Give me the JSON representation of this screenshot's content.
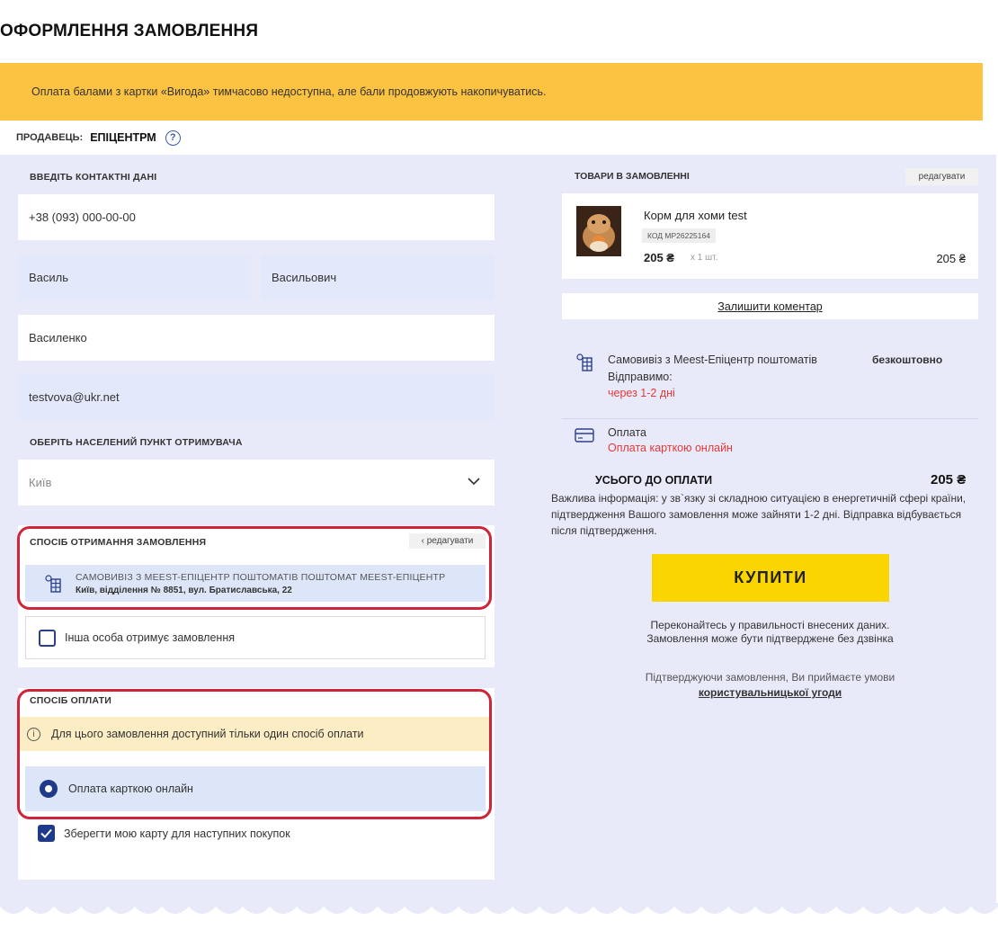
{
  "page_title": "ОФОРМЛЕННЯ ЗАМОВЛЕННЯ",
  "notice": "Оплата балами з картки «Вигода» тимчасово недоступна, але бали продовжують накопичуватись.",
  "seller": {
    "label": "ПРОДАВЕЦЬ:",
    "name": "ЕПІЦЕНТРМ"
  },
  "contacts": {
    "label": "ВВЕДІТЬ КОНТАКТНІ ДАНІ",
    "phone": "+38 (093) 000-00-00",
    "first_name": "Василь",
    "patronymic": "Васильович",
    "last_name": "Василенко",
    "email": "testvova@ukr.net"
  },
  "city": {
    "label": "ОБЕРІТЬ НАСЕЛЕНИЙ ПУНКТ ОТРИМУВАЧА",
    "value": "Київ"
  },
  "delivery": {
    "label": "СПОСІБ ОТРИМАННЯ ЗАМОВЛЕННЯ",
    "edit": "‹ редагувати",
    "option_title": "САМОВИВІЗ З MEEST-ЕПІЦЕНТР ПОШТОМАТІВ ПОШТОМАТ MEEST-ЕПІЦЕНТР",
    "option_address": "Київ, відділення № 8851, вул. Братиславська, 22",
    "other_person": "Інша особа отримує замовлення"
  },
  "payment": {
    "label": "СПОСІБ ОПЛАТИ",
    "info": "Для цього замовлення доступний тільки один спосіб оплати",
    "option": "Оплата карткою онлайн",
    "save_card": "Зберегти мою карту для наступних покупок"
  },
  "order": {
    "label": "ТОВАРИ В ЗАМОВЛЕННІ",
    "edit": "редагувати",
    "product_name": "Корм для хоми test",
    "product_code": "КОД MP26225164",
    "price": "205 ₴",
    "qty": "х 1 шт.",
    "total": "205 ₴",
    "comment": "Залишити коментар",
    "shipping_title": "Самовивіз з Meest-Епіцентр поштоматів",
    "shipping_price": "безкоштовно",
    "ship_when": "Відправимо:",
    "ship_eta": "через 1-2 дні",
    "pay_title": "Оплата",
    "pay_method": "Оплата карткою онлайн",
    "sum_label": "УСЬОГО ДО ОПЛАТИ",
    "sum_value": "205 ₴",
    "important": "Важлива інформація: у зв`язку зі складною ситуацією в енергетичній сфері країни, підтвердження Вашого замовлення може зайняти 1-2 дні. Відправка відбувається після підтвердження.",
    "buy": "КУПИТИ",
    "check_1": "Переконайтесь у правильності внесених даних.",
    "check_2": "Замовлення може бути підтверджене без дзвінка",
    "agree": "Підтверджуючи замовлення, Ви приймаєте умови",
    "agree_link": "користувальницької угоди"
  },
  "colors": {
    "accent_yellow": "#fbd500",
    "notice_bg": "#fcc342",
    "panel_bg": "#e8eaf9",
    "brand_blue": "#1e3a8a",
    "alert_red": "#e53935",
    "highlight_border": "#d0243a"
  },
  "icons": [
    "help-icon",
    "chevron-down-icon",
    "parcel-locker-icon",
    "info-icon",
    "radio-icon",
    "checkmark-icon",
    "credit-card-icon"
  ]
}
